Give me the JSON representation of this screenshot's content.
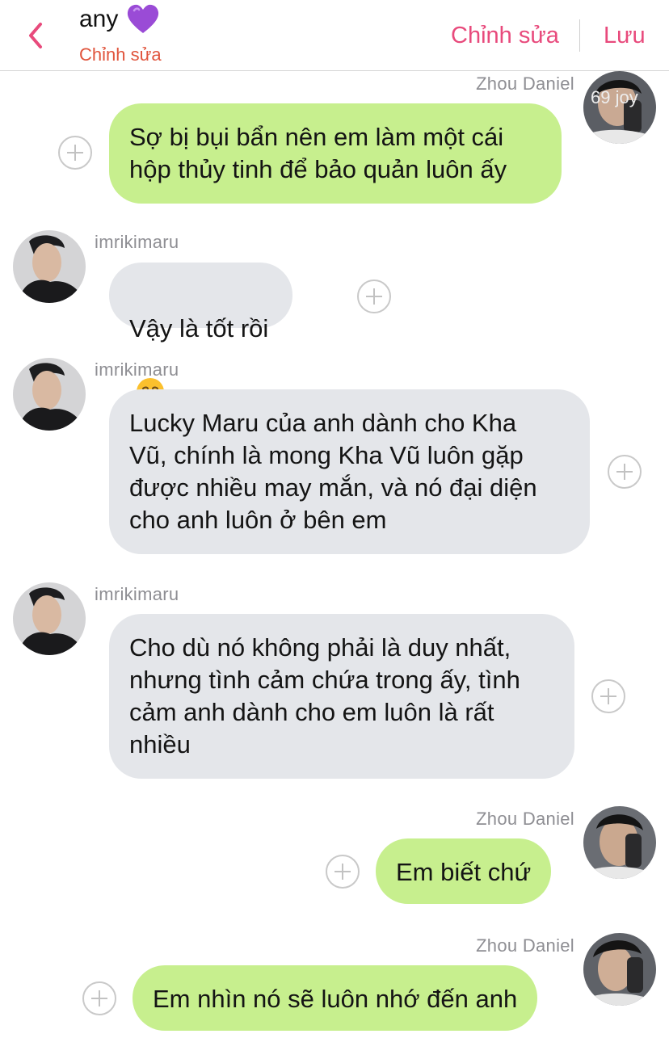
{
  "header": {
    "contact_name": "any",
    "heart_icon": "purple-heart-emoji",
    "subtitle": "Chỉnh sửa",
    "edit_label": "Chỉnh sửa",
    "save_label": "Lưu"
  },
  "colors": {
    "accent": "#e84a7c",
    "subtitle": "#e0543c",
    "sent_bubble": "#c7ef8e",
    "received_bubble": "#e4e6ea"
  },
  "messages": [
    {
      "sender": "Zhou Daniel",
      "badge": "69 joy",
      "text": "Sợ bị bụi bẩn nên em làm một cái\nhộp thủy tinh để bảo quản luôn ấy"
    },
    {
      "sender": "imrikimaru",
      "text": "Vậy là tốt rồi",
      "emoji": "☺️"
    },
    {
      "sender": "imrikimaru",
      "text": "Lucky Maru của anh dành cho Kha\nVũ, chính là mong Kha Vũ luôn gặp\nđược nhiều may mắn, và nó đại diện\ncho anh luôn ở bên em"
    },
    {
      "sender": "imrikimaru",
      "text": "Cho dù nó không phải là duy nhất,\nnhưng tình cảm chứa trong ấy, tình\ncảm anh dành cho em luôn là rất\nnhiều"
    },
    {
      "sender": "Zhou Daniel",
      "text": "Em biết chứ"
    },
    {
      "sender": "Zhou Daniel",
      "text": "Em nhìn nó sẽ luôn nhớ đến anh"
    }
  ]
}
